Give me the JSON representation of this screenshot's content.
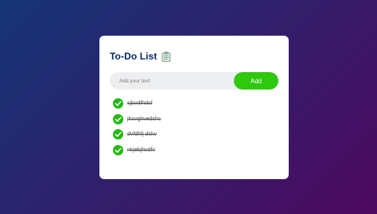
{
  "app": {
    "title": "To-Do List",
    "title_icon": "notepad-icon"
  },
  "input": {
    "value": "",
    "placeholder": "Add your text"
  },
  "add_button": {
    "label": "Add"
  },
  "tasks": [
    {
      "text": "sjbvdfhdsf",
      "completed": true
    },
    {
      "text": "jhsvghvedshc",
      "completed": true
    },
    {
      "text": "dvfdhfj dskv",
      "completed": true
    },
    {
      "text": "nkjebjhvdfv",
      "completed": true
    }
  ],
  "colors": {
    "background_start": "#153677",
    "background_end": "#4e085f",
    "title": "#002765",
    "accent_green": "#2fc80f",
    "check_green": "#21ba0f",
    "input_bg": "#edeef0"
  },
  "icons": {
    "completed": "check-circle-icon"
  }
}
